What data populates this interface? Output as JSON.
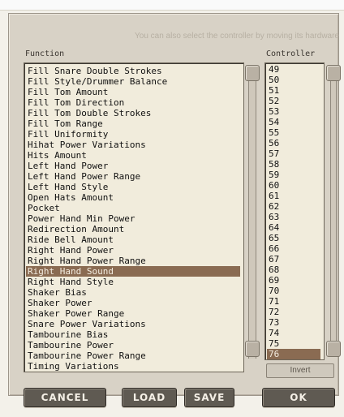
{
  "hint_text": "You can also select the controller by moving its hardware",
  "headers": {
    "function": "Function",
    "controller": "Controller"
  },
  "functions": [
    "Fill Snare Double Strokes",
    "Fill Style/Drummer Balance",
    "Fill Tom Amount",
    "Fill Tom Direction",
    "Fill Tom Double Strokes",
    "Fill Tom Range",
    "Fill Uniformity",
    "Hihat Power Variations",
    "Hits Amount",
    "Left Hand Power",
    "Left Hand Power Range",
    "Left Hand Style",
    "Open Hats Amount",
    "Pocket",
    "Power Hand Min Power",
    "Redirection Amount",
    "Ride Bell Amount",
    "Right Hand Power",
    "Right Hand Power Range",
    "Right Hand Sound",
    "Right Hand Style",
    "Shaker Bias",
    "Shaker Power",
    "Shaker Power Range",
    "Snare Power Variations",
    "Tambourine Bias",
    "Tambourine Power",
    "Tambourine Power Range",
    "Timing Variations"
  ],
  "selected_function": "Right Hand Sound",
  "controllers": [
    "49",
    "50",
    "51",
    "52",
    "53",
    "54",
    "55",
    "56",
    "57",
    "58",
    "59",
    "60",
    "61",
    "62",
    "63",
    "64",
    "65",
    "66",
    "67",
    "68",
    "69",
    "70",
    "71",
    "72",
    "73",
    "74",
    "75",
    "76"
  ],
  "selected_controller": "76",
  "buttons": {
    "invert": "Invert",
    "cancel": "CANCEL",
    "load": "LOAD",
    "save": "SAVE",
    "ok": "OK"
  },
  "icons": {
    "scroll_up": "up-arrow-icon",
    "scroll_down": "down-arrow-icon",
    "slider": "fader-knob-icon"
  },
  "colors": {
    "selection": "#8a6b52",
    "list_bg": "#f1ecdc",
    "button_bg": "#5f5a52"
  }
}
